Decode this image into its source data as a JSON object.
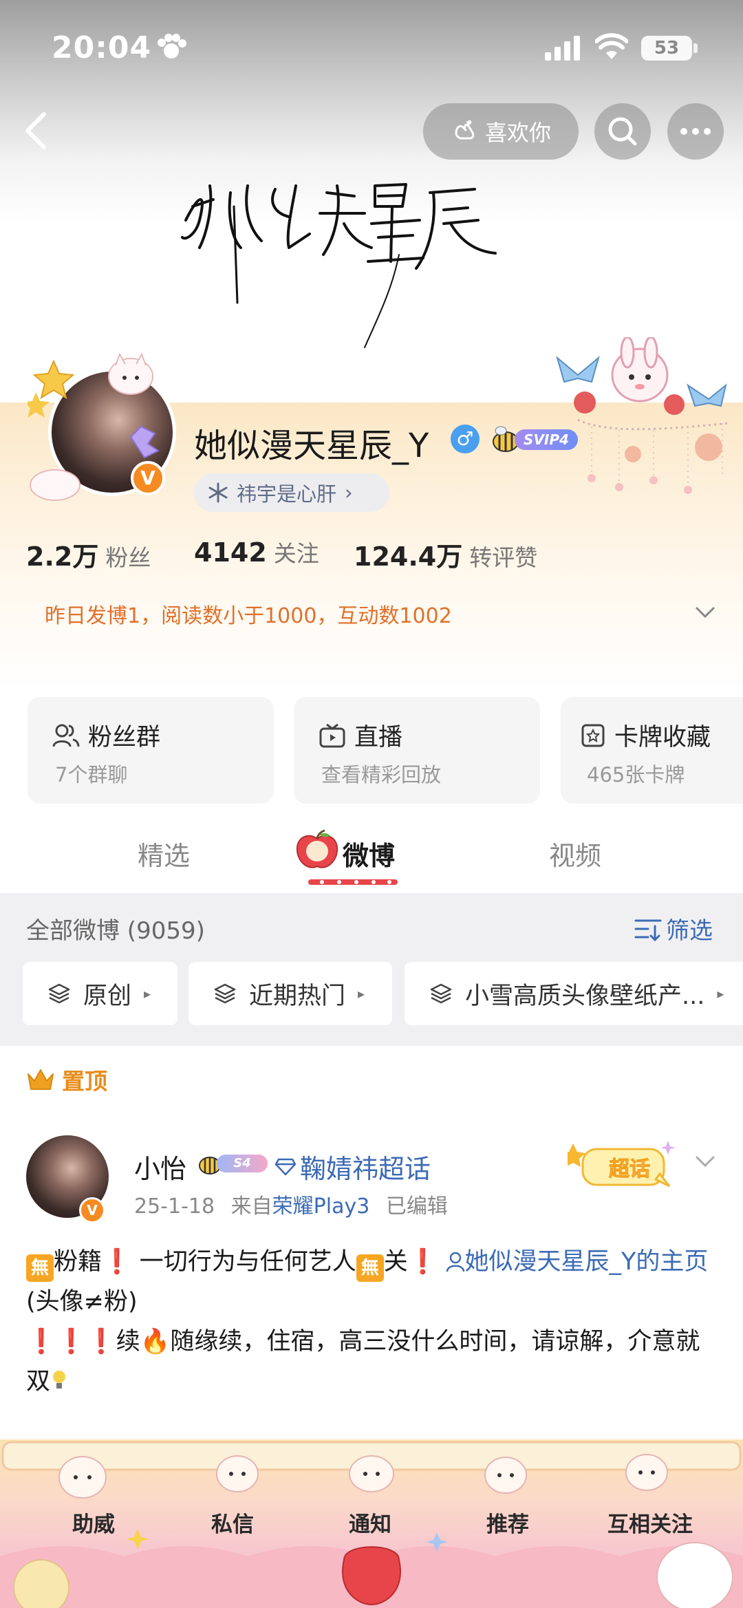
{
  "status_bar": {
    "time": "20:04",
    "battery": "53"
  },
  "top_nav": {
    "like_label": "喜欢你"
  },
  "profile": {
    "username": "她似漫天星辰_Y",
    "gender_symbol": "♂",
    "verify_symbol": "V",
    "svip_label": "SVIP4",
    "group_chip": "祎宇是心肝",
    "group_chip_arrow": "›"
  },
  "stats": {
    "fans_value": "2.2万",
    "fans_label": "粉丝",
    "follow_value": "4142",
    "follow_label": "关注",
    "likes_value": "124.4万",
    "likes_label": "转评赞"
  },
  "notice": "昨日发博1，阅读数小于1000，互动数1002",
  "cards": [
    {
      "title": "粉丝群",
      "subtitle": "7个群聊"
    },
    {
      "title": "直播",
      "subtitle": "查看精彩回放"
    },
    {
      "title": "卡牌收藏",
      "subtitle": "465张卡牌"
    }
  ],
  "tabs": {
    "featured": "精选",
    "weibo": "微博",
    "video": "视频"
  },
  "feed": {
    "all_label": "全部微博 (9059)",
    "filter_label": "筛选",
    "chips": [
      "原创",
      "近期热门",
      "小雪高质头像壁纸产..."
    ]
  },
  "pinned_label": "置顶",
  "post": {
    "author": "小怡",
    "level_badge": "S4",
    "topic": "鞠婧祎超话",
    "date": "25-1-18",
    "from_prefix": "来自",
    "source": "荣耀Play3",
    "edited": "已编辑",
    "supertopic_badge": "超话",
    "wu_glyph": "無",
    "text_a": "粉籍",
    "text_b": "一切行为与任何艺人",
    "text_c": "关",
    "link_text": "她似漫天星辰_Y的主页",
    "text_d": " (头像≠粉)",
    "text_e": "续",
    "text_f": "随缘续，住宿，高三没什么时间，请谅解，介意就双",
    "excl": "❗",
    "fire": "🔥"
  },
  "bottom_nav": [
    "助威",
    "私信",
    "通知",
    "推荐",
    "互相关注"
  ],
  "colors": {
    "accent_orange": "#f58b22",
    "link_blue": "#3c6bb5",
    "notice_orange": "#e0702a"
  }
}
